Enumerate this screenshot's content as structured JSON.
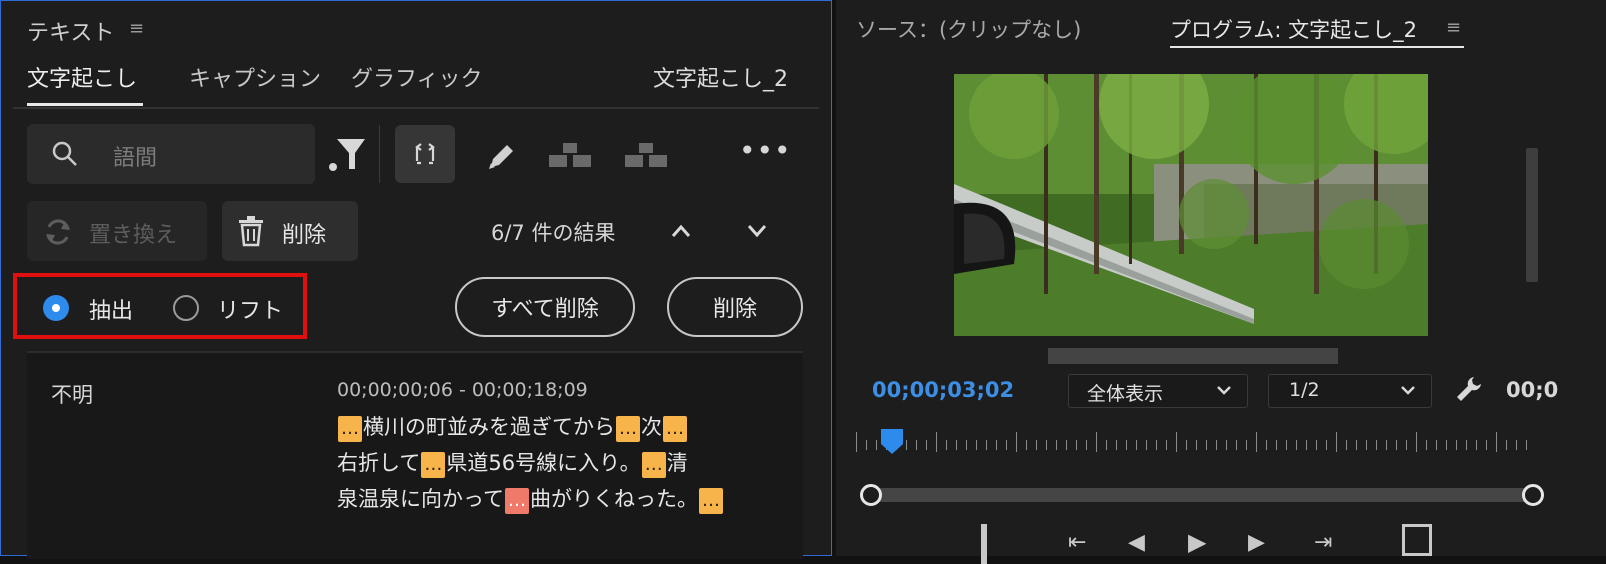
{
  "text_panel": {
    "title": "テキスト",
    "menu_icon": "≡",
    "tabs": [
      "文字起こし",
      "キャプション",
      "グラフィック"
    ],
    "active_tab_index": 0,
    "sequence_name": "文字起こし_2",
    "search": {
      "placeholder": "語間",
      "icon": "search-icon"
    },
    "replace_label": "置き換え",
    "delete_label": "削除",
    "results_text": "6/7 件の結果",
    "options": [
      "抽出",
      "リフト"
    ],
    "selected_option": "抽出",
    "delete_all_label": "すべて削除",
    "delete_pill_label": "削除",
    "speaker": "不明",
    "timecode_range": "00;00;00;06 - 00;00;18;09",
    "transcript_lines": [
      [
        "[…]",
        "横川の町並みを過ぎてから",
        "[…]",
        "次",
        "[…]"
      ],
      [
        "右折して",
        "[…]",
        "県道56号線に入り。",
        "[…]",
        "清"
      ],
      [
        "泉温泉に向かって",
        "[…red]",
        "曲がりくねった。",
        "[…]"
      ]
    ],
    "colors": {
      "selection_border": "#e01010",
      "accent": "#2d8ceb",
      "tag": "#f7b44a",
      "tag_active": "#f07a6a"
    }
  },
  "monitor_panel": {
    "source_tab": "ソース：(クリップなし)",
    "program_tab": "プログラム: 文字起こし_2",
    "menu_icon": "≡",
    "timecode": "00;00;03;02",
    "zoom_select": "全体表示",
    "resolution_select": "1/2",
    "timecode_right": "00;0",
    "playhead_color": "#2d8ceb"
  }
}
